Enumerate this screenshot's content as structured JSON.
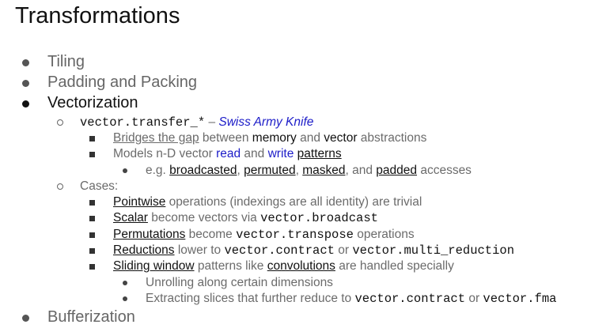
{
  "title": "Transformations",
  "items": {
    "tiling": "Tiling",
    "padding": "Padding and Packing",
    "vectorization": "Vectorization",
    "bufferization": "Bufferization"
  },
  "transfer": {
    "code": "vector.transfer_*",
    "dash": " – ",
    "desc": "Swiss Army Knife",
    "bridges": {
      "link": "Bridges the gap",
      "t1": " between ",
      "w1": "memory",
      "t2": " and ",
      "w2": "vector",
      "t3": " abstractions"
    },
    "models": {
      "t1": "Models n-D vector ",
      "read": "read",
      "t2": " and ",
      "write": "write",
      "t3": " ",
      "patterns": "patterns"
    },
    "eg": {
      "t1": "e.g. ",
      "a": "broadcasted",
      "c1": ", ",
      "b": "permuted",
      "c2": ", ",
      "c": "masked",
      "c3": ", and ",
      "d": "padded",
      "t2": " accesses"
    }
  },
  "cases": {
    "label": "Cases:",
    "pointwise": {
      "link": "Pointwise",
      "text": " operations (indexings are all identity) are trivial"
    },
    "scalar": {
      "link": "Scalar",
      "text": " become vectors via ",
      "code": "vector.broadcast"
    },
    "perm": {
      "link": "Permutations",
      "text": " become ",
      "code": "vector.transpose",
      "text2": " operations"
    },
    "red": {
      "link": "Reductions",
      "text": " lower to ",
      "code1": "vector.contract",
      "or": " or ",
      "code2": "vector.multi_reduction"
    },
    "slide": {
      "link": "Sliding window",
      "text": " patterns like ",
      "link2": "convolutions",
      "text2": " are handled specially"
    },
    "unroll": "Unrolling along certain dimensions",
    "extract": {
      "text": "Extracting slices that further reduce to ",
      "code1": "vector.contract",
      "or": " or ",
      "code2": "vector.fma"
    }
  }
}
